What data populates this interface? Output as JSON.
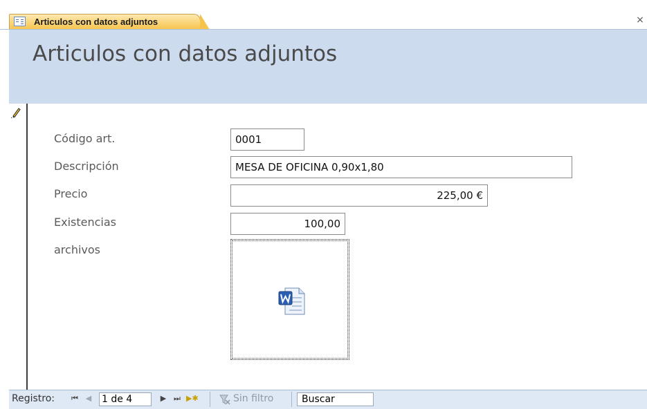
{
  "tab": {
    "label": "Articulos con datos adjuntos",
    "icon": "form-icon",
    "close_label": "×"
  },
  "header": {
    "title": "Articulos con datos adjuntos"
  },
  "record_selector": {
    "icon": "pencil-icon"
  },
  "form": {
    "codigo_label": "Código art.",
    "codigo_value": "0001",
    "descripcion_label": "Descripción",
    "descripcion_value": "MESA DE OFICINA 0,90x1,80",
    "precio_label": "Precio",
    "precio_value": "225,00 €",
    "existencias_label": "Existencias",
    "existencias_value": "100,00",
    "archivos_label": "archivos",
    "attachment_icon": "word-document-icon"
  },
  "navbar": {
    "label": "Registro:",
    "first_icon": "first-record-icon",
    "prev_icon": "previous-record-icon",
    "current_record": "1 de 4",
    "next_icon": "next-record-icon",
    "last_icon": "last-record-icon",
    "new_icon": "new-record-icon",
    "filter_label": "Sin filtro",
    "search_value": "Buscar"
  },
  "colors": {
    "tab_active": "#f7c34c",
    "header_band": "#cddbef",
    "navbar_bg": "#dfe8f5"
  }
}
